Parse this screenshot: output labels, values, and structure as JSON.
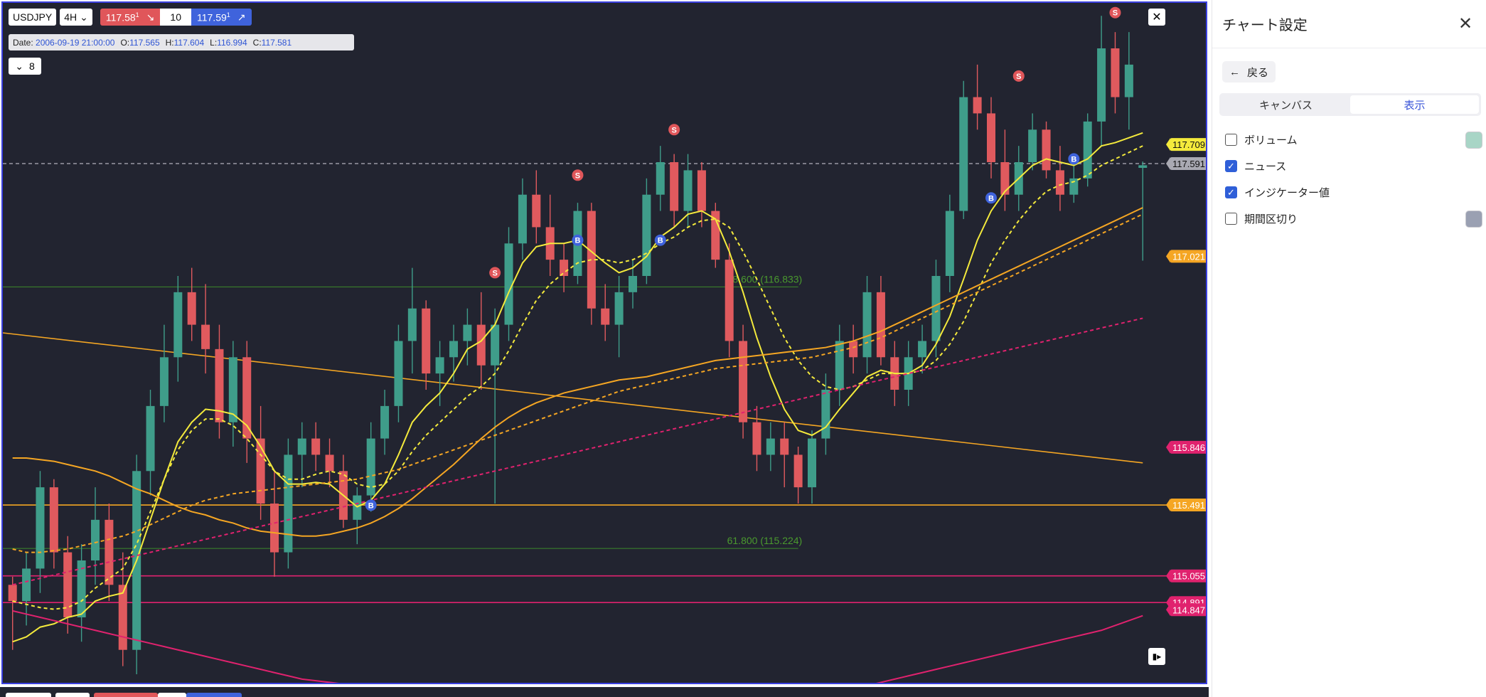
{
  "toolbar": {
    "symbol": "USDJPY",
    "timeframe": "4H",
    "sell_price": "117.58",
    "sell_sup": "1",
    "quantity": "10",
    "buy_price": "117.59",
    "buy_sup": "1",
    "collapse_count": "8"
  },
  "ohlc": {
    "date_label": "Date:",
    "date": "2006-09-19 21:00:00",
    "o_label": "O:",
    "o": "117.565",
    "h_label": "H:",
    "h": "117.604",
    "l_label": "L:",
    "l": "116.994",
    "c_label": "C:",
    "c": "117.581"
  },
  "settings": {
    "title": "チャート設定",
    "back_label": "戻る",
    "tabs": [
      {
        "label": "キャンバス",
        "active": false
      },
      {
        "label": "表示",
        "active": true
      }
    ],
    "options": [
      {
        "label": "ボリューム",
        "checked": false,
        "swatch": "#a8d5c6"
      },
      {
        "label": "ニュース",
        "checked": true,
        "swatch": null
      },
      {
        "label": "インジケーター値",
        "checked": true,
        "swatch": null
      },
      {
        "label": "期間区切り",
        "checked": false,
        "swatch": "#9aa0b2"
      }
    ]
  },
  "colors": {
    "background": "#222430",
    "up": "#3f9d8a",
    "down": "#e05a5e",
    "ma_fast": "#f4ea3c",
    "ma_slow": "#f5a623",
    "ma_long": "#e0226e",
    "fib": "#3d8a2a",
    "accent": "#3a40e0"
  },
  "chart_data": {
    "type": "candlestick",
    "symbol": "USDJPY",
    "timeframe": "4H",
    "ylim": [
      114.38,
      118.58
    ],
    "current_price": 117.591,
    "candles": [
      [
        115.0,
        115.05,
        114.6,
        114.9
      ],
      [
        114.9,
        115.2,
        114.75,
        115.1
      ],
      [
        115.1,
        115.7,
        114.95,
        115.6
      ],
      [
        115.6,
        115.65,
        115.1,
        115.2
      ],
      [
        115.2,
        115.3,
        114.7,
        114.8
      ],
      [
        114.8,
        115.25,
        114.65,
        115.15
      ],
      [
        115.15,
        115.6,
        115.0,
        115.4
      ],
      [
        115.4,
        115.5,
        114.9,
        115.0
      ],
      [
        115.0,
        115.2,
        114.5,
        114.6
      ],
      [
        114.6,
        115.8,
        114.45,
        115.7
      ],
      [
        115.7,
        116.2,
        115.55,
        116.1
      ],
      [
        116.1,
        116.6,
        116.0,
        116.4
      ],
      [
        116.4,
        116.9,
        116.25,
        116.8
      ],
      [
        116.8,
        116.95,
        116.5,
        116.6
      ],
      [
        116.6,
        116.85,
        116.3,
        116.45
      ],
      [
        116.45,
        116.6,
        115.9,
        116.0
      ],
      [
        116.0,
        116.5,
        115.85,
        116.4
      ],
      [
        116.4,
        116.5,
        115.75,
        115.9
      ],
      [
        115.9,
        116.1,
        115.4,
        115.5
      ],
      [
        115.5,
        115.7,
        115.05,
        115.2
      ],
      [
        115.2,
        115.9,
        115.1,
        115.8
      ],
      [
        115.8,
        116.0,
        115.6,
        115.9
      ],
      [
        115.9,
        116.0,
        115.7,
        115.8
      ],
      [
        115.8,
        115.9,
        115.6,
        115.7
      ],
      [
        115.7,
        115.8,
        115.35,
        115.4
      ],
      [
        115.4,
        115.6,
        115.25,
        115.55
      ],
      [
        115.55,
        116.0,
        115.45,
        115.9
      ],
      [
        115.9,
        116.2,
        115.8,
        116.1
      ],
      [
        116.1,
        116.6,
        116.0,
        116.5
      ],
      [
        116.5,
        116.95,
        116.3,
        116.7
      ],
      [
        116.7,
        116.75,
        116.2,
        116.3
      ],
      [
        116.3,
        116.5,
        116.1,
        116.4
      ],
      [
        116.4,
        116.6,
        116.25,
        116.5
      ],
      [
        116.5,
        116.7,
        116.35,
        116.6
      ],
      [
        116.6,
        116.8,
        116.2,
        116.35
      ],
      [
        116.35,
        116.7,
        115.5,
        116.6
      ],
      [
        116.6,
        117.2,
        116.5,
        117.1
      ],
      [
        117.1,
        117.5,
        117.0,
        117.4
      ],
      [
        117.4,
        117.55,
        117.1,
        117.2
      ],
      [
        117.2,
        117.4,
        116.9,
        117.0
      ],
      [
        117.0,
        117.1,
        116.8,
        116.9
      ],
      [
        116.9,
        117.35,
        116.85,
        117.3
      ],
      [
        117.3,
        117.35,
        116.6,
        116.7
      ],
      [
        116.7,
        116.85,
        116.5,
        116.6
      ],
      [
        116.6,
        116.9,
        116.4,
        116.8
      ],
      [
        116.8,
        117.0,
        116.7,
        116.9
      ],
      [
        116.9,
        117.5,
        116.85,
        117.4
      ],
      [
        117.4,
        117.7,
        117.3,
        117.6
      ],
      [
        117.6,
        117.65,
        117.2,
        117.3
      ],
      [
        117.3,
        117.65,
        117.2,
        117.55
      ],
      [
        117.55,
        117.6,
        117.2,
        117.3
      ],
      [
        117.3,
        117.35,
        116.95,
        117.0
      ],
      [
        117.0,
        117.1,
        116.4,
        116.5
      ],
      [
        116.5,
        116.6,
        115.9,
        116.0
      ],
      [
        116.0,
        116.1,
        115.7,
        115.8
      ],
      [
        115.8,
        116.0,
        115.7,
        115.9
      ],
      [
        115.9,
        116.0,
        115.6,
        115.8
      ],
      [
        115.8,
        115.85,
        115.5,
        115.6
      ],
      [
        115.6,
        115.95,
        115.5,
        115.9
      ],
      [
        115.9,
        116.3,
        115.8,
        116.2
      ],
      [
        116.2,
        116.6,
        116.1,
        116.5
      ],
      [
        116.5,
        116.6,
        116.3,
        116.4
      ],
      [
        116.4,
        116.9,
        116.3,
        116.8
      ],
      [
        116.8,
        116.9,
        116.35,
        116.4
      ],
      [
        116.4,
        116.5,
        116.1,
        116.2
      ],
      [
        116.2,
        116.5,
        116.1,
        116.4
      ],
      [
        116.4,
        116.6,
        116.3,
        116.5
      ],
      [
        116.5,
        117.0,
        116.4,
        116.9
      ],
      [
        116.9,
        117.4,
        116.8,
        117.3
      ],
      [
        117.3,
        118.1,
        117.25,
        118.0
      ],
      [
        118.0,
        118.2,
        117.8,
        117.9
      ],
      [
        117.9,
        118.0,
        117.5,
        117.6
      ],
      [
        117.6,
        117.8,
        117.3,
        117.4
      ],
      [
        117.4,
        117.7,
        117.3,
        117.6
      ],
      [
        117.6,
        117.9,
        117.55,
        117.8
      ],
      [
        117.8,
        117.85,
        117.5,
        117.55
      ],
      [
        117.55,
        117.7,
        117.3,
        117.4
      ],
      [
        117.4,
        117.6,
        117.35,
        117.5
      ],
      [
        117.5,
        117.9,
        117.45,
        117.85
      ],
      [
        117.85,
        118.5,
        117.7,
        118.3
      ],
      [
        118.3,
        118.4,
        117.9,
        118.0
      ],
      [
        118.0,
        118.4,
        117.8,
        118.2
      ],
      [
        117.565,
        117.604,
        116.994,
        117.581
      ]
    ],
    "series": [
      {
        "name": "",
        "style": "solid",
        "color": "#f4ea3c",
        "values": [
          114.65,
          114.68,
          114.74,
          114.76,
          114.8,
          114.82,
          114.9,
          114.93,
          114.95,
          115.15,
          115.4,
          115.65,
          115.88,
          116.0,
          116.08,
          116.07,
          116.05,
          115.98,
          115.85,
          115.7,
          115.62,
          115.62,
          115.63,
          115.62,
          115.55,
          115.48,
          115.52,
          115.62,
          115.8,
          116.0,
          116.1,
          116.18,
          116.3,
          116.45,
          116.5,
          116.6,
          116.8,
          116.98,
          117.08,
          117.1,
          117.1,
          117.12,
          117.05,
          116.98,
          116.92,
          116.95,
          117.02,
          117.14,
          117.2,
          117.28,
          117.3,
          117.25,
          117.05,
          116.8,
          116.52,
          116.28,
          116.08,
          115.95,
          115.92,
          115.97,
          116.08,
          116.18,
          116.28,
          116.32,
          116.3,
          116.3,
          116.35,
          116.48,
          116.65,
          116.88,
          117.12,
          117.3,
          117.42,
          117.5,
          117.58,
          117.62,
          117.6,
          117.58,
          117.62,
          117.7,
          117.72,
          117.75,
          117.78
        ]
      },
      {
        "name": "",
        "style": "dashed",
        "color": "#f4ea3c",
        "values": [
          114.9,
          114.88,
          114.86,
          114.85,
          114.86,
          114.9,
          114.98,
          115.04,
          115.1,
          115.25,
          115.45,
          115.65,
          115.83,
          115.95,
          116.02,
          116.02,
          115.98,
          115.9,
          115.8,
          115.7,
          115.65,
          115.65,
          115.68,
          115.7,
          115.68,
          115.62,
          115.6,
          115.62,
          115.7,
          115.82,
          115.92,
          116.0,
          116.08,
          116.16,
          116.22,
          116.3,
          116.44,
          116.6,
          116.75,
          116.85,
          116.92,
          116.98,
          117.0,
          117.0,
          116.98,
          117.0,
          117.04,
          117.1,
          117.14,
          117.2,
          117.24,
          117.25,
          117.2,
          117.05,
          116.88,
          116.7,
          116.52,
          116.38,
          116.28,
          116.22,
          116.2,
          116.22,
          116.26,
          116.3,
          116.3,
          116.3,
          116.32,
          116.38,
          116.48,
          116.62,
          116.8,
          116.98,
          117.12,
          117.24,
          117.34,
          117.42,
          117.46,
          117.48,
          117.52,
          117.58,
          117.62,
          117.66,
          117.7
        ]
      },
      {
        "name": "",
        "style": "solid",
        "color": "#f5a623",
        "values": [
          115.78,
          115.78,
          115.77,
          115.76,
          115.74,
          115.72,
          115.7,
          115.67,
          115.63,
          115.59,
          115.56,
          115.52,
          115.48,
          115.45,
          115.43,
          115.4,
          115.38,
          115.35,
          115.33,
          115.32,
          115.31,
          115.3,
          115.3,
          115.31,
          115.33,
          115.35,
          115.38,
          115.42,
          115.47,
          115.53,
          115.6,
          115.67,
          115.74,
          115.82,
          115.9,
          115.97,
          116.03,
          116.08,
          116.12,
          116.15,
          116.18,
          116.2,
          116.22,
          116.24,
          116.26,
          116.27,
          116.28,
          116.3,
          116.32,
          116.34,
          116.36,
          116.38,
          116.39,
          116.4,
          116.41,
          116.42,
          116.43,
          116.44,
          116.45,
          116.46,
          116.48,
          116.5,
          116.53,
          116.56,
          116.6,
          116.64,
          116.68,
          116.72,
          116.76,
          116.8,
          116.84,
          116.88,
          116.92,
          116.96,
          117.0,
          117.04,
          117.08,
          117.12,
          117.16,
          117.2,
          117.24,
          117.28,
          117.32
        ]
      },
      {
        "name": "",
        "style": "dashed",
        "color": "#f5a623",
        "values": [
          115.22,
          115.2,
          115.2,
          115.21,
          115.22,
          115.24,
          115.26,
          115.28,
          115.3,
          115.33,
          115.37,
          115.41,
          115.45,
          115.49,
          115.52,
          115.54,
          115.56,
          115.57,
          115.58,
          115.59,
          115.6,
          115.61,
          115.62,
          115.63,
          115.64,
          115.65,
          115.67,
          115.69,
          115.71,
          115.74,
          115.77,
          115.8,
          115.83,
          115.86,
          115.89,
          115.92,
          115.95,
          115.98,
          116.01,
          116.04,
          116.07,
          116.1,
          116.13,
          116.16,
          116.19,
          116.21,
          116.23,
          116.25,
          116.27,
          116.29,
          116.31,
          116.33,
          116.34,
          116.35,
          116.36,
          116.37,
          116.38,
          116.39,
          116.4,
          116.42,
          116.44,
          116.46,
          116.49,
          116.52,
          116.56,
          116.6,
          116.64,
          116.68,
          116.72,
          116.76,
          116.8,
          116.84,
          116.88,
          116.92,
          116.96,
          117.0,
          117.04,
          117.08,
          117.12,
          117.16,
          117.2,
          117.24,
          117.28
        ]
      },
      {
        "name": "",
        "style": "dashed",
        "color": "#e0226e",
        "values": [
          115.0,
          115.02,
          115.04,
          115.06,
          115.08,
          115.1,
          115.12,
          115.14,
          115.16,
          115.18,
          115.2,
          115.22,
          115.24,
          115.26,
          115.28,
          115.3,
          115.32,
          115.34,
          115.36,
          115.38,
          115.4,
          115.42,
          115.44,
          115.46,
          115.48,
          115.5,
          115.52,
          115.54,
          115.56,
          115.58,
          115.6,
          115.62,
          115.64,
          115.66,
          115.68,
          115.7,
          115.72,
          115.74,
          115.76,
          115.78,
          115.8,
          115.82,
          115.84,
          115.86,
          115.88,
          115.9,
          115.92,
          115.94,
          115.96,
          115.98,
          116.0,
          116.02,
          116.04,
          116.06,
          116.08,
          116.1,
          116.12,
          116.14,
          116.16,
          116.18,
          116.2,
          116.22,
          116.24,
          116.26,
          116.28,
          116.3,
          116.32,
          116.34,
          116.36,
          116.38,
          116.4,
          116.42,
          116.44,
          116.46,
          116.48,
          116.5,
          116.52,
          116.54,
          116.56,
          116.58,
          116.6,
          116.62,
          116.64
        ]
      },
      {
        "name": "",
        "style": "solid",
        "color": "#e0226e",
        "values": [
          114.84,
          114.82,
          114.8,
          114.78,
          114.76,
          114.74,
          114.72,
          114.7,
          114.68,
          114.66,
          114.64,
          114.62,
          114.6,
          114.58,
          114.56,
          114.54,
          114.52,
          114.5,
          114.48,
          114.46,
          114.44,
          114.42,
          114.41,
          114.4,
          114.39,
          114.38,
          114.37,
          114.36,
          114.35,
          114.34,
          114.33,
          114.32,
          114.31,
          114.3,
          114.29,
          114.28,
          114.27,
          114.26,
          114.25,
          114.24,
          114.24,
          114.23,
          114.23,
          114.22,
          114.22,
          114.22,
          114.21,
          114.21,
          114.21,
          114.21,
          114.21,
          114.22,
          114.22,
          114.23,
          114.24,
          114.25,
          114.26,
          114.28,
          114.3,
          114.32,
          114.34,
          114.36,
          114.38,
          114.4,
          114.42,
          114.44,
          114.46,
          114.48,
          114.5,
          114.52,
          114.54,
          114.56,
          114.58,
          114.6,
          114.62,
          114.64,
          114.66,
          114.68,
          114.7,
          114.72,
          114.75,
          114.78,
          114.81
        ]
      }
    ],
    "horizontal_lines": [
      {
        "price": 115.491,
        "color": "#f5a623"
      },
      {
        "price": 115.055,
        "color": "#e0226e"
      },
      {
        "price": 114.891,
        "color": "#e0226e"
      }
    ],
    "trendline": {
      "from": [
        0,
        116.55
      ],
      "to": [
        82,
        115.75
      ],
      "color": "#f5a623"
    },
    "fibonacci": [
      {
        "label": "38.600 (116.833)",
        "price": 116.833,
        "x_from": 0,
        "x_to": 57
      },
      {
        "label": "61.800 (115.224)",
        "price": 115.224,
        "x_from": 0,
        "x_to": 57
      }
    ],
    "price_labels": [
      {
        "text": "117.709",
        "price": 117.709,
        "bg": "#f4ea3c",
        "fg": "#111"
      },
      {
        "text": "117.591",
        "price": 117.591,
        "bg": "#a9a9b2",
        "fg": "#111"
      },
      {
        "text": "117.021",
        "price": 117.021,
        "bg": "#f5a623",
        "fg": "#fff"
      },
      {
        "text": "115.846",
        "price": 115.846,
        "bg": "#e0226e",
        "fg": "#fff"
      },
      {
        "text": "115.491",
        "price": 115.491,
        "bg": "#f5a623",
        "fg": "#fff"
      },
      {
        "text": "115.055",
        "price": 115.055,
        "bg": "#e0226e",
        "fg": "#fff"
      },
      {
        "text": "114.891",
        "price": 114.891,
        "bg": "#e0226e",
        "fg": "#fff"
      },
      {
        "text": "114.847",
        "price": 114.847,
        "bg": "#e0226e",
        "fg": "#fff"
      }
    ],
    "markers": [
      {
        "type": "B",
        "index": 26,
        "price": 115.49
      },
      {
        "type": "S",
        "index": 35,
        "price": 116.92
      },
      {
        "type": "B",
        "index": 41,
        "price": 117.12
      },
      {
        "type": "S",
        "index": 41,
        "price": 117.52
      },
      {
        "type": "B",
        "index": 47,
        "price": 117.12
      },
      {
        "type": "S",
        "index": 48,
        "price": 117.8
      },
      {
        "type": "B",
        "index": 71,
        "price": 117.38
      },
      {
        "type": "S",
        "index": 73,
        "price": 118.13
      },
      {
        "type": "B",
        "index": 77,
        "price": 117.62
      },
      {
        "type": "S",
        "index": 80,
        "price": 118.52
      }
    ]
  }
}
